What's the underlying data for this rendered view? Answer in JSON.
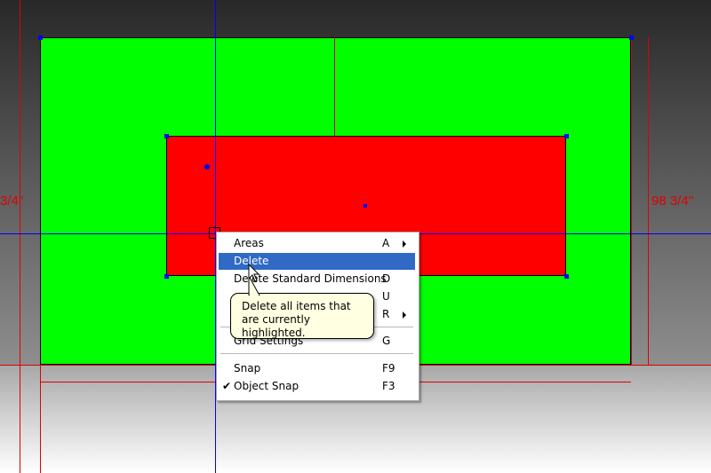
{
  "drawing": {
    "colors": {
      "outer_area": "#00ff00",
      "inner_area": "#ff0000",
      "dimension_line": "#e00000",
      "crosshair": "#0000ff",
      "vertex": "#0000ff"
    },
    "dimension_left": "3/4\"",
    "dimension_right": "98 3/4\""
  },
  "context_menu": {
    "items": [
      {
        "label": "Areas",
        "shortcut": "A",
        "submenu": true,
        "highlighted": false
      },
      {
        "label": "Delete",
        "shortcut": "",
        "submenu": false,
        "highlighted": true
      },
      {
        "label": "Delete Standard Dimensions",
        "shortcut": "D",
        "submenu": false,
        "highlighted": false
      },
      {
        "label": "",
        "shortcut": "U",
        "submenu": false,
        "highlighted": false
      },
      {
        "label": "",
        "shortcut": "R",
        "submenu": true,
        "highlighted": false
      },
      {
        "label": "Grid Settings",
        "shortcut": "G",
        "submenu": false,
        "highlighted": false
      },
      {
        "label": "Snap",
        "shortcut": "F9",
        "submenu": false,
        "highlighted": false
      },
      {
        "label": "Object Snap",
        "shortcut": "F3",
        "submenu": false,
        "checked": true,
        "highlighted": false
      }
    ],
    "check_glyph": "✔"
  },
  "tooltip": {
    "text": "Delete all items that are currently highlighted."
  }
}
